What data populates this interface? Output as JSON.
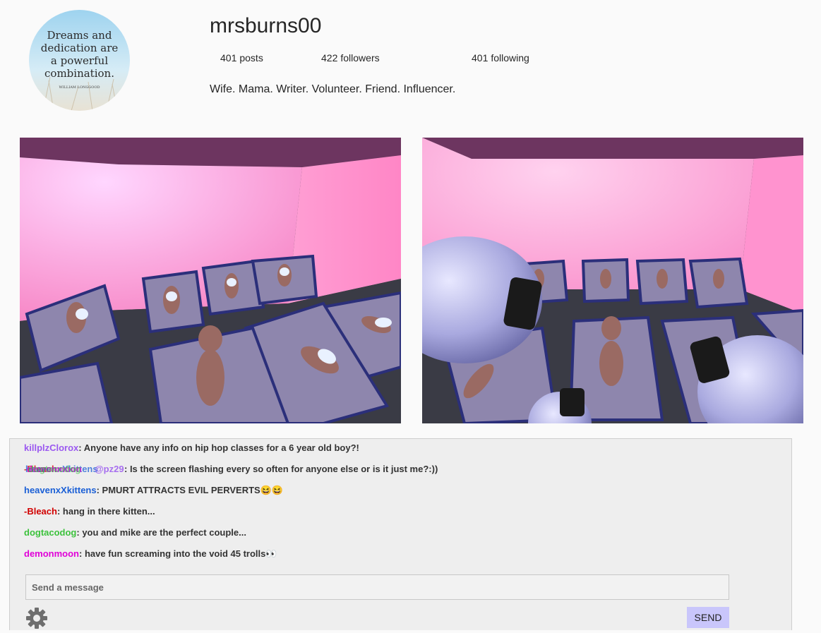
{
  "profile": {
    "username": "mrsburns00",
    "posts_count": "401",
    "posts_label": "posts",
    "followers_count": "422",
    "followers_label": "followers",
    "following_count": "401",
    "following_label": "following",
    "bio": "Wife. Mama. Writer. Volunteer. Friend. Influencer.",
    "avatar_quote_lines": [
      "Dreams and",
      "dedication are",
      "a powerful",
      "combination."
    ],
    "avatar_quote_author": "WILLIAM LONGGOOD"
  },
  "chat": {
    "messages": [
      {
        "user": "killplzClorox",
        "color": "#9b59f0",
        "text": ": Anyone have any info on hip hop classes for a 6 year old boy?!"
      },
      {
        "user": "heavenxXkittens",
        "color": "#1a5fd6",
        "text": ": PMURT ATTRACTS EVIL PERVERTS😆😆"
      },
      {
        "user": "-Bleach",
        "color": "#d10000",
        "text": ": hang in there kitten..."
      },
      {
        "user": "dogtacodog",
        "color": "#3cc23c",
        "text": ": you and mike are the perfect couple..."
      },
      {
        "user": "demonmoon",
        "color": "#e000d8",
        "text": ": have fun screaming into the void 45 trolls👀"
      }
    ],
    "overlap_message": {
      "layers": [
        {
          "text": "-Bleach",
          "color": "#d10000"
        },
        {
          "text": "heavenxXkittens",
          "color": "#1a5fd6"
        },
        {
          "text": "demonmoon",
          "color": "#e000d8"
        },
        {
          "text": "dogtacodog",
          "color": "#3cc23c"
        },
        {
          "text": "@pz29",
          "color": "#9b59f0"
        }
      ],
      "text": ": Is the screen flashing every so often for anyone else or is it just me?:))"
    },
    "input_placeholder": "Send a message",
    "send_label": "SEND",
    "settings_icon": "gear-icon"
  }
}
